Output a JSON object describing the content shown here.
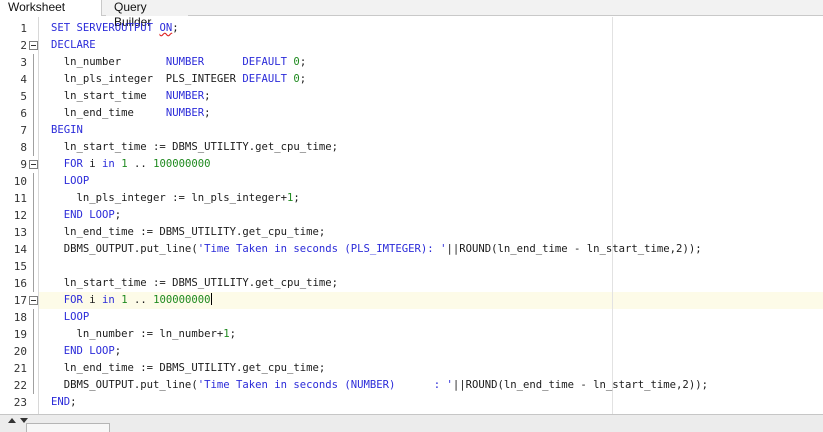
{
  "tabs": [
    {
      "label": "Worksheet",
      "active": true
    },
    {
      "label": "Query Builder",
      "active": false
    }
  ],
  "current_line": 17,
  "lines": [
    {
      "n": "1",
      "code": [
        [
          "kw",
          "SET SERVEROUTPUT "
        ],
        [
          "kw squiggle",
          "ON"
        ],
        [
          "",
          "; "
        ]
      ]
    },
    {
      "n": "2",
      "fold": true,
      "code": [
        [
          "kw",
          "DECLARE"
        ]
      ]
    },
    {
      "n": "3",
      "code": [
        [
          "",
          "  ln_number       "
        ],
        [
          "kw",
          "NUMBER"
        ],
        [
          "",
          "      "
        ],
        [
          "kw",
          "DEFAULT"
        ],
        [
          "",
          " "
        ],
        [
          "num",
          "0"
        ],
        [
          "",
          ";"
        ]
      ]
    },
    {
      "n": "4",
      "code": [
        [
          "",
          "  ln_pls_integer  PLS_INTEGER "
        ],
        [
          "kw",
          "DEFAULT"
        ],
        [
          "",
          " "
        ],
        [
          "num",
          "0"
        ],
        [
          "",
          ";"
        ]
      ]
    },
    {
      "n": "5",
      "code": [
        [
          "",
          "  ln_start_time   "
        ],
        [
          "kw",
          "NUMBER"
        ],
        [
          "",
          ";"
        ]
      ]
    },
    {
      "n": "6",
      "code": [
        [
          "",
          "  ln_end_time     "
        ],
        [
          "kw",
          "NUMBER"
        ],
        [
          "",
          ";"
        ]
      ]
    },
    {
      "n": "7",
      "code": [
        [
          "kw",
          "BEGIN"
        ]
      ]
    },
    {
      "n": "8",
      "code": [
        [
          "",
          "  ln_start_time := DBMS_UTILITY.get_cpu_time;"
        ]
      ]
    },
    {
      "n": "9",
      "fold": true,
      "code": [
        [
          "kw",
          "  FOR"
        ],
        [
          "",
          " i "
        ],
        [
          "kw",
          "in"
        ],
        [
          "",
          " "
        ],
        [
          "num",
          "1"
        ],
        [
          "",
          " .. "
        ],
        [
          "num",
          "100000000"
        ]
      ]
    },
    {
      "n": "10",
      "code": [
        [
          "kw",
          "  LOOP"
        ]
      ]
    },
    {
      "n": "11",
      "code": [
        [
          "",
          "    ln_pls_integer := ln_pls_integer+"
        ],
        [
          "num",
          "1"
        ],
        [
          "",
          ";"
        ]
      ]
    },
    {
      "n": "12",
      "code": [
        [
          "kw",
          "  END LOOP"
        ],
        [
          "",
          ";"
        ]
      ]
    },
    {
      "n": "13",
      "code": [
        [
          "",
          "  ln_end_time := DBMS_UTILITY.get_cpu_time;"
        ]
      ]
    },
    {
      "n": "14",
      "code": [
        [
          "",
          "  DBMS_OUTPUT.put_line("
        ],
        [
          "str",
          "'Time Taken in seconds (PLS_IMTEGER): '"
        ],
        [
          "",
          "||ROUND(ln_end_time - ln_start_time,2));"
        ]
      ]
    },
    {
      "n": "15",
      "code": []
    },
    {
      "n": "16",
      "code": [
        [
          "",
          "  ln_start_time := DBMS_UTILITY.get_cpu_time;"
        ]
      ]
    },
    {
      "n": "17",
      "fold": true,
      "caret": true,
      "code": [
        [
          "kw",
          "  FOR"
        ],
        [
          "",
          " i "
        ],
        [
          "kw",
          "in"
        ],
        [
          "",
          " "
        ],
        [
          "num",
          "1"
        ],
        [
          "",
          " .. "
        ],
        [
          "num",
          "100000000"
        ]
      ]
    },
    {
      "n": "18",
      "code": [
        [
          "kw",
          "  LOOP"
        ]
      ]
    },
    {
      "n": "19",
      "code": [
        [
          "",
          "    ln_number := ln_number+"
        ],
        [
          "num",
          "1"
        ],
        [
          "",
          ";"
        ]
      ]
    },
    {
      "n": "20",
      "code": [
        [
          "kw",
          "  END LOOP"
        ],
        [
          "",
          ";"
        ]
      ]
    },
    {
      "n": "21",
      "code": [
        [
          "",
          "  ln_end_time := DBMS_UTILITY.get_cpu_time;"
        ]
      ]
    },
    {
      "n": "22",
      "code": [
        [
          "",
          "  DBMS_OUTPUT.put_line("
        ],
        [
          "str",
          "'Time Taken in seconds (NUMBER)      : '"
        ],
        [
          "",
          "||ROUND(ln_end_time - ln_start_time,2));"
        ]
      ]
    },
    {
      "n": "23",
      "code": [
        [
          "kw",
          "END"
        ],
        [
          "",
          ";"
        ]
      ]
    }
  ]
}
